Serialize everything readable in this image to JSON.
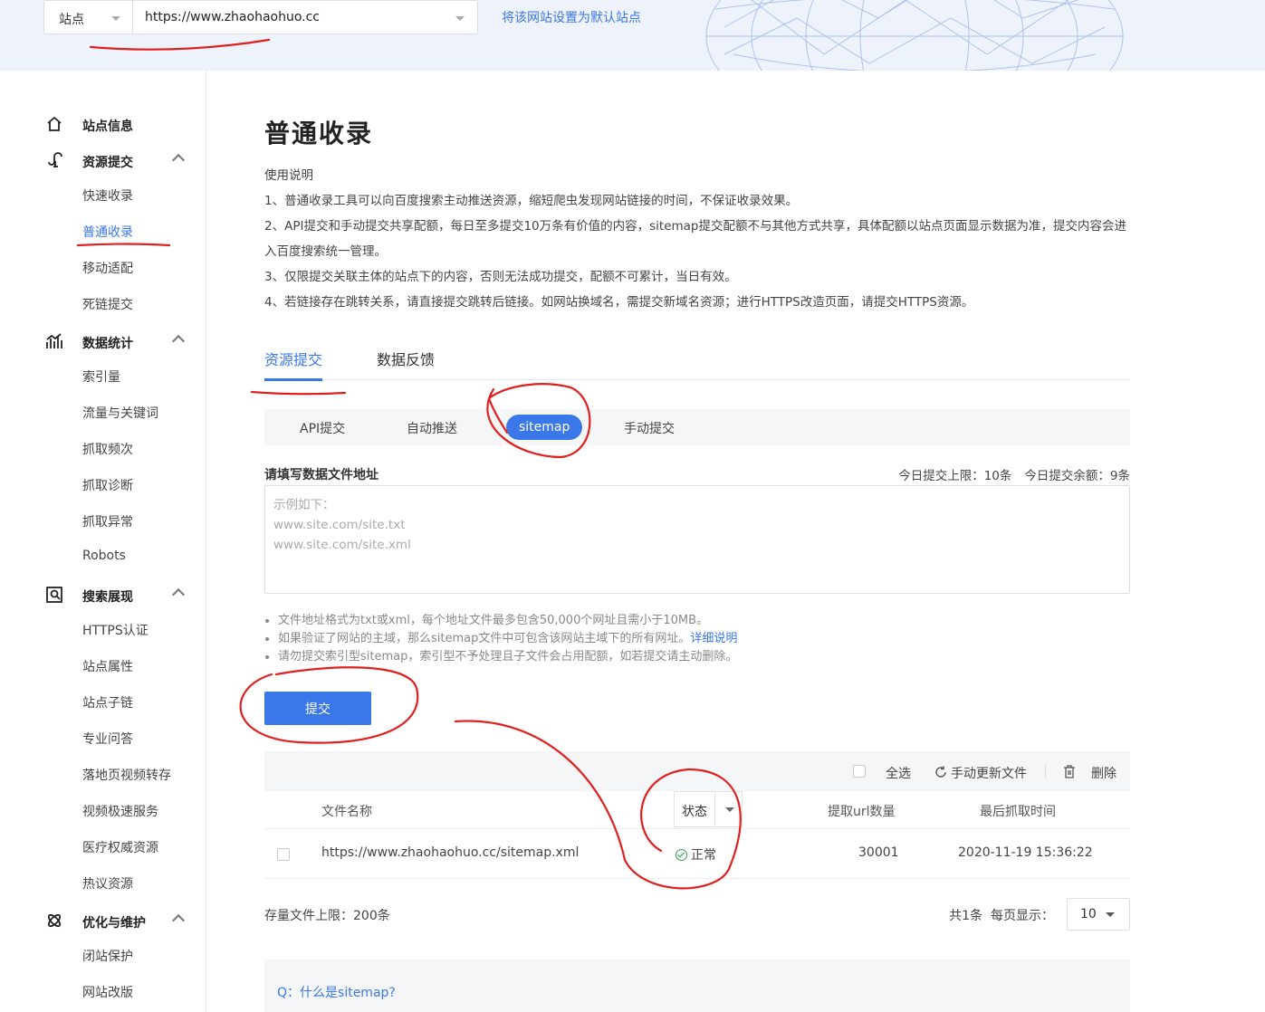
{
  "topbar": {
    "site_label": "站点",
    "site_url": "https://www.zhaohaohuo.cc",
    "set_default": "将该网站设置为默认站点"
  },
  "sidebar": {
    "site_info": "站点信息",
    "groups": [
      {
        "title": "资源提交",
        "icon": "plant-icon",
        "items": [
          "快速收录",
          "普通收录",
          "移动适配",
          "死链提交"
        ]
      },
      {
        "title": "数据统计",
        "icon": "stats-icon",
        "items": [
          "索引量",
          "流量与关键词",
          "抓取频次",
          "抓取诊断",
          "抓取异常",
          "Robots"
        ]
      },
      {
        "title": "搜索展现",
        "icon": "search-display-icon",
        "items": [
          "HTTPS认证",
          "站点属性",
          "站点子链",
          "专业问答",
          "落地页视频转存",
          "视频极速服务",
          "医疗权威资源",
          "热议资源"
        ]
      },
      {
        "title": "优化与维护",
        "icon": "atom-icon",
        "items": [
          "闭站保护",
          "网站改版"
        ]
      }
    ],
    "active_item": "普通收录"
  },
  "main": {
    "title": "普通收录",
    "instructions": [
      "使用说明",
      "1、普通收录工具可以向百度搜索主动推送资源，缩短爬虫发现网站链接的时间，不保证收录效果。",
      "2、API提交和手动提交共享配额，每日至多提交10万条有价值的内容，sitemap提交配额不与其他方式共享，具体配额以站点页面显示数据为准，提交内容会进入百度搜索统一管理。",
      "3、仅限提交关联主体的站点下的内容，否则无法成功提交，配额不可累计，当日有效。",
      "4、若链接存在跳转关系，请直接提交跳转后链接。如网站换域名，需提交新域名资源；进行HTTPS改造页面，请提交HTTPS资源。"
    ],
    "tabs": [
      "资源提交",
      "数据反馈"
    ],
    "subtabs": [
      "API提交",
      "自动推送",
      "sitemap",
      "手动提交"
    ],
    "field_label": "请填写数据文件地址",
    "quota_limit": "今日提交上限：10条",
    "quota_remaining": "今日提交余额：9条",
    "textarea_placeholder": "示例如下：\nwww.site.com/site.txt\nwww.site.com/site.xml",
    "notes": {
      "n1": "文件地址格式为txt或xml，每个地址文件最多包含50,000个网址且需小于10MB。",
      "n2": "如果验证了网站的主域，那么sitemap文件中可包含该网站主域下的所有网址。",
      "n2_link": "详细说明",
      "n3": "请勿提交索引型sitemap，索引型不予处理且子文件会占用配额，如若提交请主动删除。"
    },
    "submit": "提交"
  },
  "table": {
    "select_all": "全选",
    "refresh": "手动更新文件",
    "delete": "删除",
    "headers": {
      "file": "文件名称",
      "status": "状态",
      "url_count": "提取url数量",
      "last_crawl": "最后抓取时间"
    },
    "rows": [
      {
        "file": "https://www.zhaohaohuo.cc/sitemap.xml",
        "status": "正常",
        "url_count": "30001",
        "last_crawl": "2020-11-19 15:36:22"
      }
    ],
    "storage_limit": "存量文件上限：200条",
    "total": "共1条",
    "per_page_label": "每页显示：",
    "per_page": "10"
  },
  "faq": {
    "q1": "Q：什么是sitemap?"
  },
  "colors": {
    "accent": "#3a77e8",
    "annotation": "#e0201e",
    "ok": "#29a745"
  }
}
